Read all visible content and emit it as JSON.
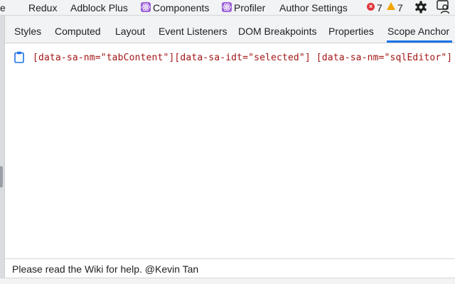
{
  "panel_tabs": {
    "partial": "e",
    "redux": "Redux",
    "adblock": "Adblock Plus",
    "components": "Components",
    "profiler": "Profiler",
    "author_settings": "Author Settings",
    "error_count": "7",
    "warning_count": "7"
  },
  "sidebar_tabs": [
    {
      "label": "Styles"
    },
    {
      "label": "Computed"
    },
    {
      "label": "Layout"
    },
    {
      "label": "Event Listeners"
    },
    {
      "label": "DOM Breakpoints"
    },
    {
      "label": "Properties"
    },
    {
      "label": "Scope Anchor",
      "active": true
    }
  ],
  "content": {
    "selector": "[data-sa-nm=\"tabContent\"][data-sa-idt=\"selected\"] [data-sa-nm=\"sqlEditor\"]"
  },
  "footer": {
    "prefix": "Please read the ",
    "link": "Wiki",
    "suffix": " for help. @Kevin Tan"
  },
  "colors": {
    "accent": "#1a73e8",
    "selector_text": "#a31515",
    "error": "#e0343a",
    "warning": "#f2a600",
    "react_badge": "#9b5cd6"
  },
  "icons": [
    "react-icon",
    "error-icon",
    "warning-icon",
    "gear-icon",
    "inspect-user-icon",
    "clipboard-icon"
  ]
}
